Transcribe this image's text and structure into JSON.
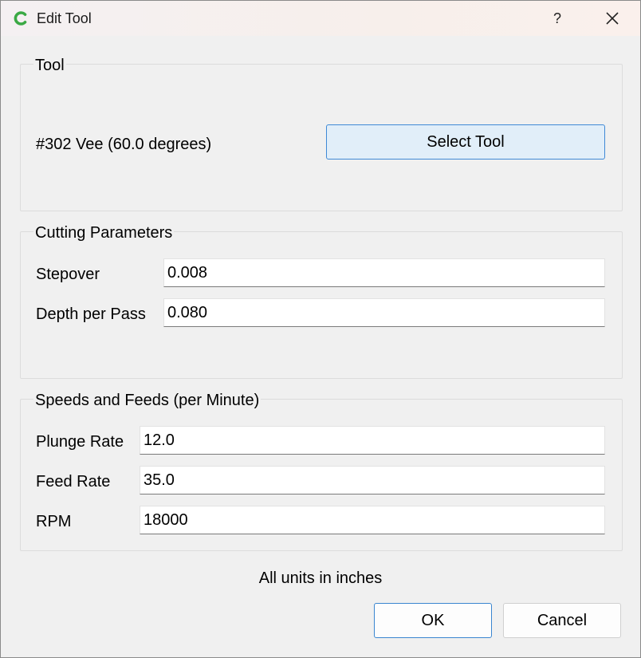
{
  "window": {
    "title": "Edit Tool",
    "help_label": "?",
    "accent_color": "#3f89d6",
    "icon_color": "#3aa945"
  },
  "tool_group": {
    "title": "Tool",
    "tool_name": "#302 Vee (60.0 degrees)",
    "select_label": "Select Tool"
  },
  "cutting_group": {
    "title": "Cutting Parameters",
    "stepover_label": "Stepover",
    "stepover_value": "0.008",
    "depth_label": "Depth per Pass",
    "depth_value": "0.080"
  },
  "speeds_group": {
    "title": "Speeds and Feeds (per Minute)",
    "plunge_label": "Plunge Rate",
    "plunge_value": "12.0",
    "feed_label": "Feed Rate",
    "feed_value": "35.0",
    "rpm_label": "RPM",
    "rpm_value": "18000"
  },
  "footer": {
    "units_note": "All units in inches",
    "ok_label": "OK",
    "cancel_label": "Cancel"
  }
}
